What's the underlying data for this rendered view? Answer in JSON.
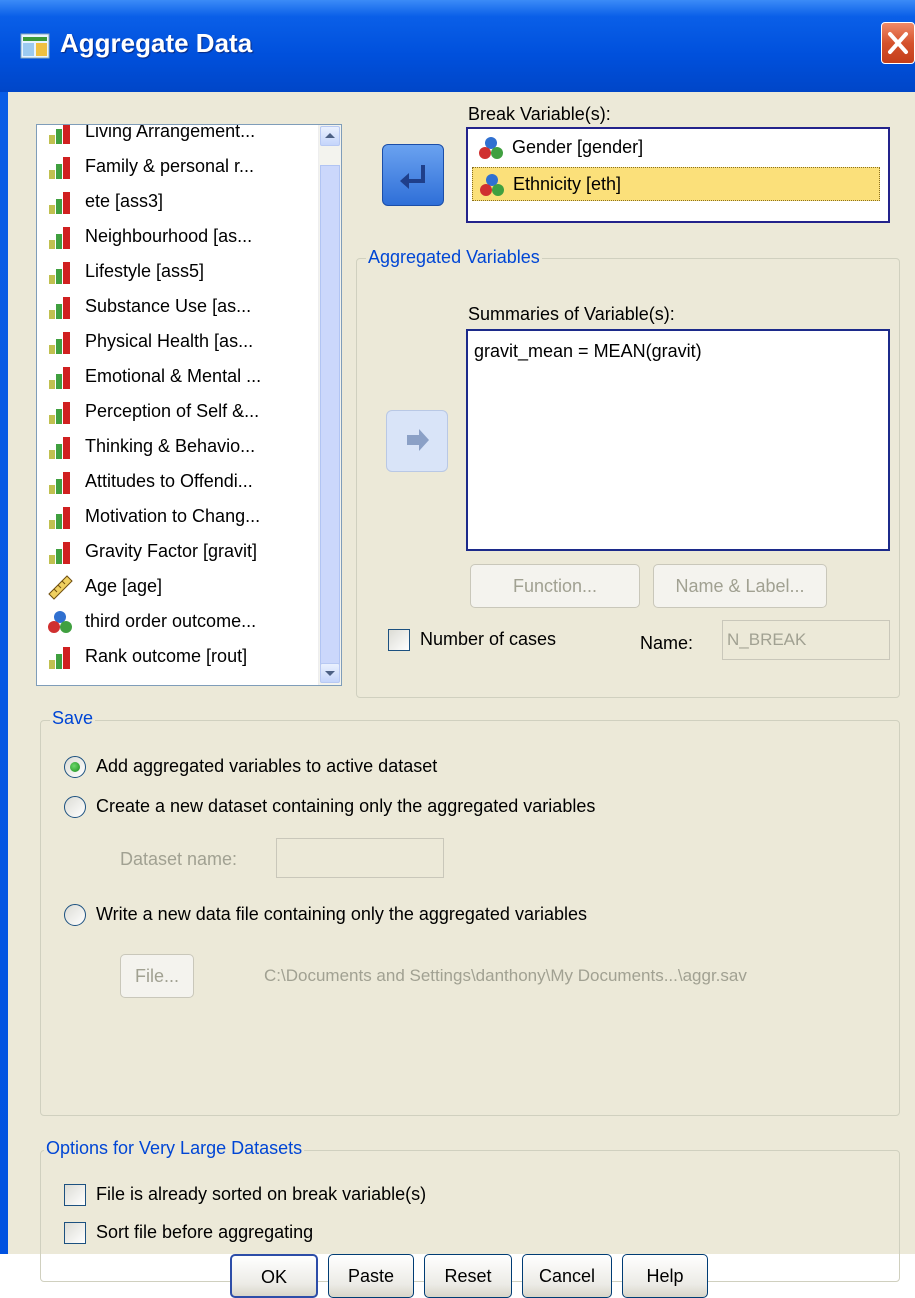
{
  "window": {
    "title": "Aggregate Data"
  },
  "source_list": {
    "items": [
      {
        "label": "Living Arrangement...",
        "icon": "scale-icon"
      },
      {
        "label": "Family & personal r...",
        "icon": "scale-icon"
      },
      {
        "label": "ete [ass3]",
        "icon": "scale-icon"
      },
      {
        "label": "Neighbourhood [as...",
        "icon": "scale-icon"
      },
      {
        "label": "Lifestyle [ass5]",
        "icon": "scale-icon"
      },
      {
        "label": "Substance Use [as...",
        "icon": "scale-icon"
      },
      {
        "label": "Physical Health [as...",
        "icon": "scale-icon"
      },
      {
        "label": "Emotional & Mental ...",
        "icon": "scale-icon"
      },
      {
        "label": "Perception of Self &...",
        "icon": "scale-icon"
      },
      {
        "label": "Thinking & Behavio...",
        "icon": "scale-icon"
      },
      {
        "label": "Attitudes to Offendi...",
        "icon": "scale-icon"
      },
      {
        "label": "Motivation to Chang...",
        "icon": "scale-icon"
      },
      {
        "label": "Gravity Factor [gravit]",
        "icon": "scale-icon"
      },
      {
        "label": "Age [age]",
        "icon": "ruler-icon"
      },
      {
        "label": "third order outcome...",
        "icon": "nominal-icon"
      },
      {
        "label": "Rank outcome [rout]",
        "icon": "scale-icon"
      }
    ]
  },
  "break": {
    "label": "Break Variable(s):",
    "items": [
      {
        "label": "Gender [gender]",
        "selected": false
      },
      {
        "label": "Ethnicity [eth]",
        "selected": true
      }
    ]
  },
  "aggregated": {
    "group_title": "Aggregated Variables",
    "summaries_label": "Summaries of Variable(s):",
    "summaries": [
      "gravit_mean = MEAN(gravit)"
    ],
    "function_button": "Function...",
    "name_label_button": "Name & Label...",
    "num_cases_label": "Number of cases",
    "name_label": "Name:",
    "name_value": "N_BREAK"
  },
  "save": {
    "group_title": "Save",
    "option1": "Add aggregated variables to active dataset",
    "option2": "Create a new dataset containing only the aggregated variables",
    "dataset_name_label": "Dataset name:",
    "option3": "Write a new data file containing only the aggregated variables",
    "file_button": "File...",
    "file_path": "C:\\Documents and Settings\\danthony\\My Documents...\\aggr.sav",
    "selected_option": 1
  },
  "options": {
    "group_title": "Options for Very Large Datasets",
    "sorted_label": "File is already sorted on break variable(s)",
    "sort_label": "Sort file before aggregating"
  },
  "buttons": {
    "ok": "OK",
    "paste": "Paste",
    "reset": "Reset",
    "cancel": "Cancel",
    "help": "Help"
  }
}
